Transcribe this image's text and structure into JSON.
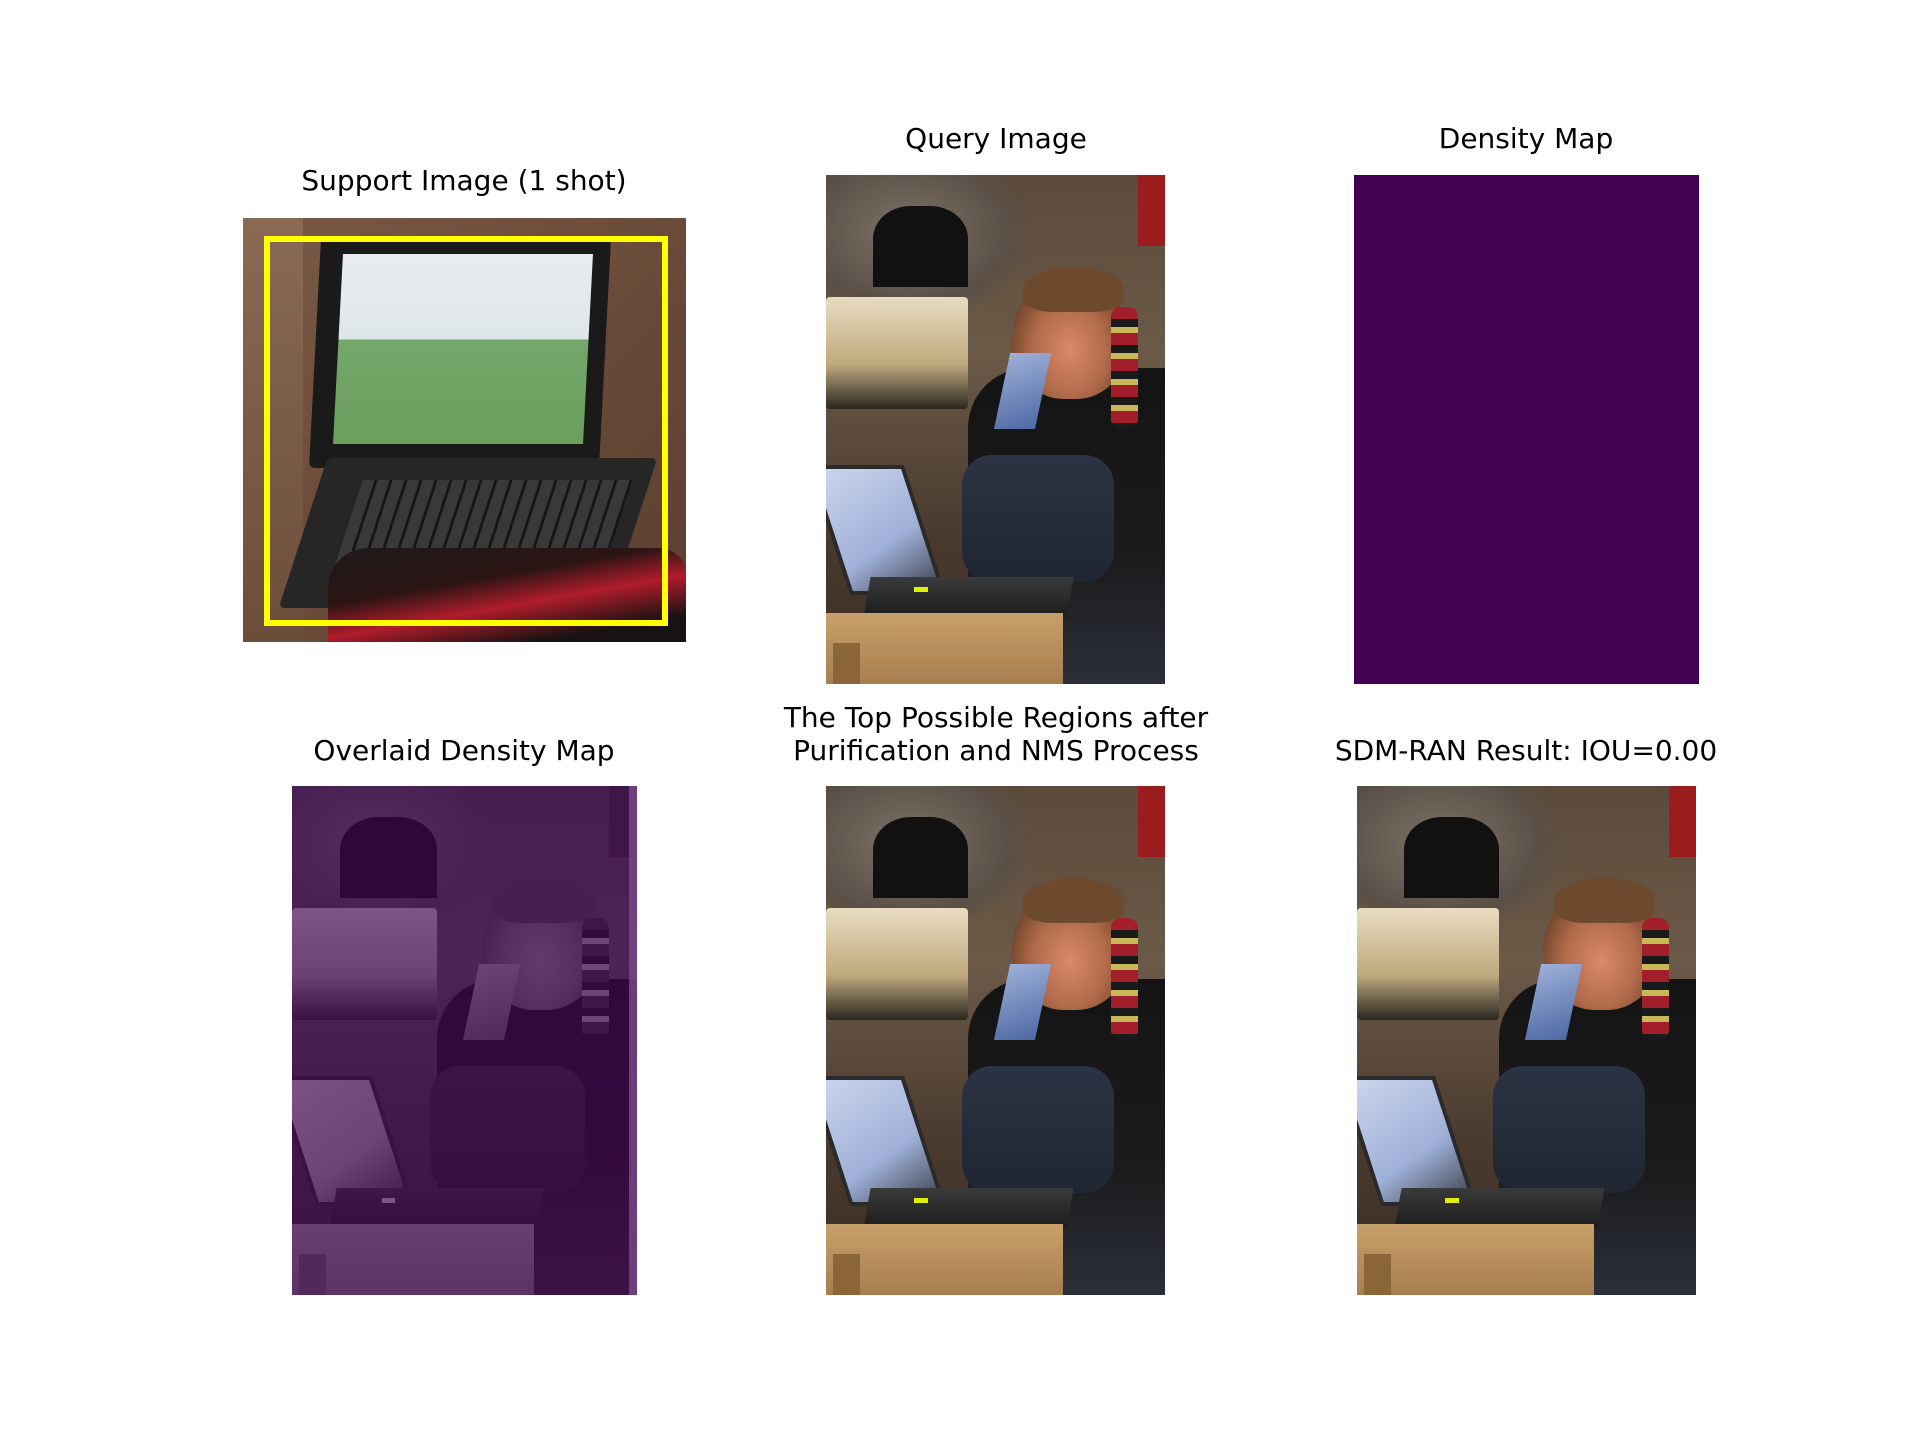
{
  "panels": {
    "support": {
      "title": "Support Image (1 shot)",
      "box_color": "#ffff00"
    },
    "query": {
      "title": "Query Image"
    },
    "density": {
      "title": "Density Map",
      "fill_color": "#440154"
    },
    "overlaid": {
      "title": "Overlaid Density Map"
    },
    "regions": {
      "title_line1": "The Top Possible Regions after",
      "title_line2": "Purification and NMS Process"
    },
    "result": {
      "title": "SDM-RAN Result: IOU=0.00"
    }
  }
}
